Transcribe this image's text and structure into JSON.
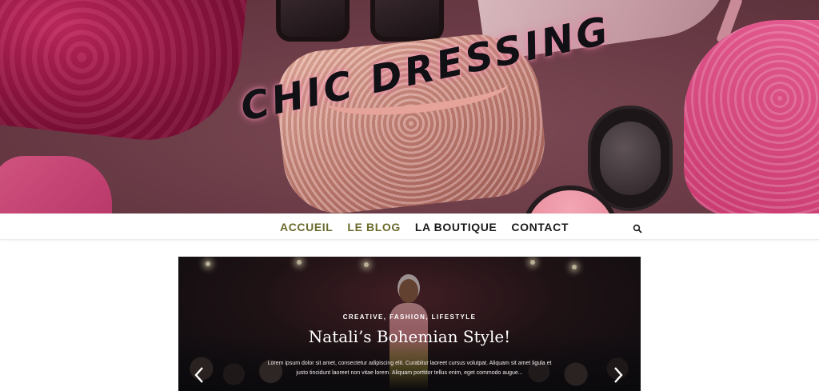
{
  "header": {
    "site_title": "CHIC DRESSING"
  },
  "nav": {
    "items": [
      {
        "label": "ACCUEIL",
        "active": true
      },
      {
        "label": "LE BLOG",
        "active": true
      },
      {
        "label": "LA BOUTIQUE",
        "active": false
      },
      {
        "label": "CONTACT",
        "active": false
      }
    ],
    "search_icon": "search-icon",
    "active_color": "#6b6a2c"
  },
  "slider": {
    "categories": "CREATIVE, FASHION, LIFESTYLE",
    "title": "Natali’s Bohemian Style!",
    "excerpt": "Lorem ipsum dolor sit amet, consectetur adipiscing elit. Curabitur laoreet cursus volutpat. Aliquam sit amet ligula et justo tincidunt laoreet non vitae lorem. Aliquam porttitor tellus enim, eget commodo augue...",
    "prev_icon": "chevron-left-icon",
    "next_icon": "chevron-right-icon"
  }
}
